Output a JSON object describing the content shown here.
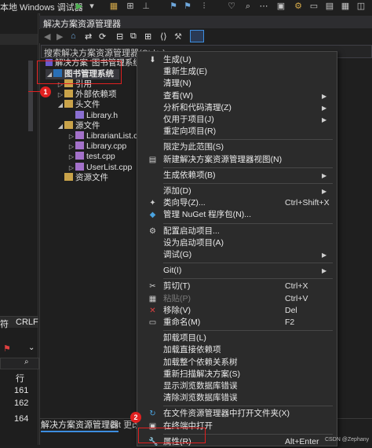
{
  "window": {
    "title_fragment": "本地 Windows 调试器"
  },
  "solution_explorer": {
    "header": "解决方案资源管理器",
    "search_placeholder": "搜索解决方案资源管理器(Ctrl+;)",
    "solution_row": "解决方案 '图书管理系统' (1",
    "project_row": "图书管理系统",
    "tree": [
      {
        "label": "引用",
        "depth": 2,
        "expand": "collapsed"
      },
      {
        "label": "外部依赖项",
        "depth": 2,
        "expand": "collapsed"
      },
      {
        "label": "头文件",
        "depth": 2,
        "expand": "expanded"
      },
      {
        "label": "Library.h",
        "depth": 3,
        "expand": "none"
      },
      {
        "label": "源文件",
        "depth": 2,
        "expand": "expanded"
      },
      {
        "label": "LibrarianList.cpp",
        "depth": 3,
        "expand": "collapsed"
      },
      {
        "label": "Library.cpp",
        "depth": 3,
        "expand": "collapsed"
      },
      {
        "label": "test.cpp",
        "depth": 3,
        "expand": "collapsed"
      },
      {
        "label": "UserList.cpp",
        "depth": 3,
        "expand": "collapsed"
      },
      {
        "label": "资源文件",
        "depth": 2,
        "expand": "none"
      }
    ],
    "tabs": [
      "解决方案资源管理器",
      "Git 更改"
    ]
  },
  "left_panel": {
    "status_left": "符",
    "status_right": "CRLF",
    "col_header": "行",
    "line_numbers": [
      "161",
      "162",
      "164"
    ]
  },
  "context_menu": {
    "items": [
      {
        "label": "生成(U)",
        "icon": "build-icon"
      },
      {
        "label": "重新生成(E)"
      },
      {
        "label": "清理(N)"
      },
      {
        "label": "查看(W)",
        "submenu": true
      },
      {
        "label": "分析和代码清理(Z)",
        "submenu": true
      },
      {
        "label": "仅用于项目(J)",
        "submenu": true
      },
      {
        "label": "重定向项目(R)"
      },
      {
        "sep": true
      },
      {
        "label": "限定为此范围(S)"
      },
      {
        "label": "新建解决方案资源管理器视图(N)",
        "icon": "new-view-icon"
      },
      {
        "sep": true
      },
      {
        "label": "生成依赖项(B)",
        "submenu": true
      },
      {
        "sep": true
      },
      {
        "label": "添加(D)",
        "submenu": true
      },
      {
        "label": "类向导(Z)...",
        "shortcut": "Ctrl+Shift+X",
        "icon": "class-wizard-icon"
      },
      {
        "label": "管理 NuGet 程序包(N)...",
        "icon": "nuget-icon"
      },
      {
        "sep": true
      },
      {
        "label": "配置启动项目...",
        "icon": "gear-icon"
      },
      {
        "label": "设为启动项目(A)"
      },
      {
        "label": "调试(G)",
        "submenu": true
      },
      {
        "sep": true
      },
      {
        "label": "Git(I)",
        "submenu": true
      },
      {
        "sep": true
      },
      {
        "label": "剪切(T)",
        "shortcut": "Ctrl+X",
        "icon": "scissors-icon"
      },
      {
        "label": "粘贴(P)",
        "shortcut": "Ctrl+V",
        "icon": "paste-icon",
        "disabled": true
      },
      {
        "label": "移除(V)",
        "shortcut": "Del",
        "icon": "remove-icon"
      },
      {
        "label": "重命名(M)",
        "shortcut": "F2",
        "icon": "rename-icon"
      },
      {
        "sep": true
      },
      {
        "label": "卸载项目(L)"
      },
      {
        "label": "加载直接依赖项"
      },
      {
        "label": "加载整个依赖关系树"
      },
      {
        "label": "重新扫描解决方案(S)"
      },
      {
        "label": "显示浏览数据库错误"
      },
      {
        "label": "清除浏览数据库错误"
      },
      {
        "sep": true
      },
      {
        "label": "在文件资源管理器中打开文件夹(X)",
        "icon": "folder-open-icon"
      },
      {
        "label": "在终端中打开",
        "icon": "terminal-icon"
      },
      {
        "sep": true
      },
      {
        "label": "属性(R)",
        "shortcut": "Alt+Enter",
        "icon": "wrench-icon"
      }
    ]
  },
  "annotations": {
    "badge1": "1",
    "badge2": "2",
    "watermark": "CSDN @Zephany"
  },
  "colors": {
    "accent": "#3d8ee0",
    "highlight": "#e02020",
    "menu_bg": "#2b2b2b"
  }
}
